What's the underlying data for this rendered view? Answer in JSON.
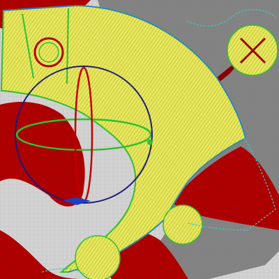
{
  "app": {
    "view": "3d-print-preview",
    "icons": {
      "gizmo": "rotation-gizmo-icon",
      "brim": "brim-circle-icon"
    }
  },
  "colors": {
    "bed_grid": "#d2d2d2",
    "bed_dark": "#767676",
    "infill_yellow": "#e8e85c",
    "perimeter_green": "#2fbf2f",
    "support_red": "#b40000",
    "outline_blue": "#2a6cff",
    "travel_cyan": "#33cccc",
    "gizmo_navy": "#1b1b7a"
  }
}
